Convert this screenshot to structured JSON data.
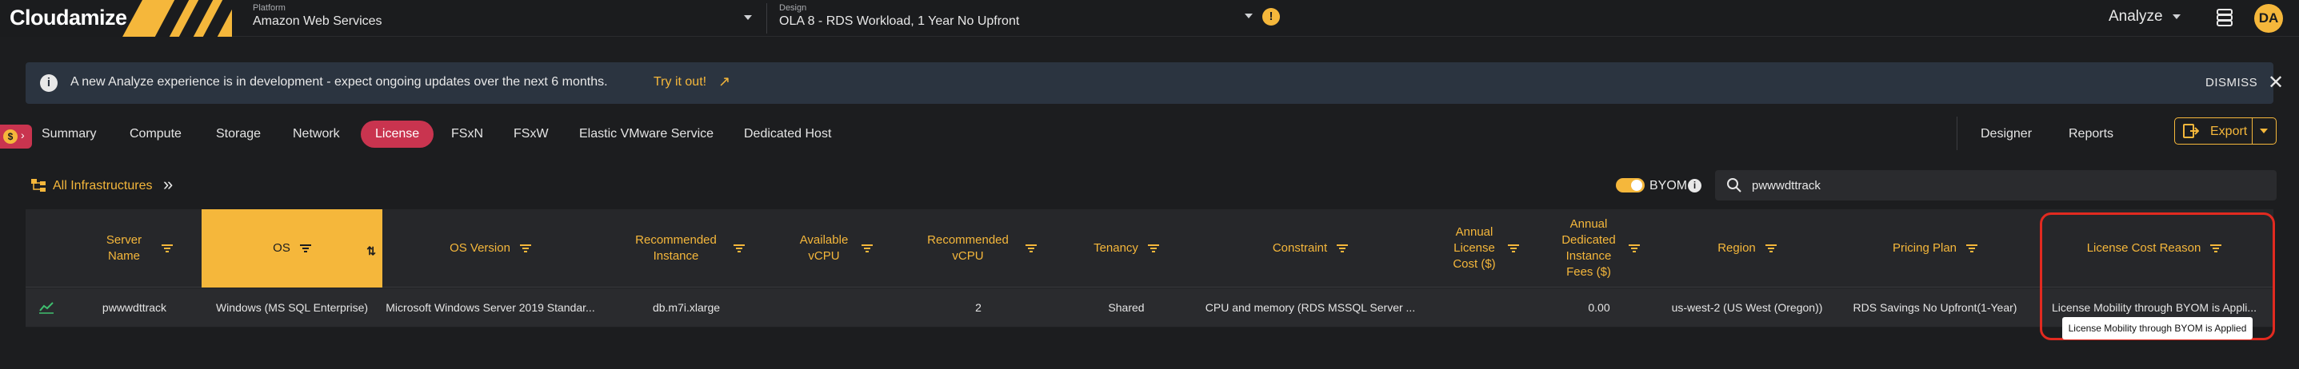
{
  "app": {
    "logo": "Cloudamize",
    "platform": {
      "caption": "Platform",
      "value": "Amazon Web Services"
    },
    "design": {
      "caption": "Design",
      "value": "OLA 8 - RDS Workload, 1 Year No Upfront"
    },
    "analyze_label": "Analyze",
    "avatar_initials": "DA",
    "accent_color": "#f5b73b",
    "active_tab_color": "#c9344f"
  },
  "banner": {
    "text": "A new Analyze experience is in development - expect ongoing updates over the next 6 months.",
    "link": "Try it out!",
    "dismiss": "DISMISS"
  },
  "tabs": [
    {
      "label": "Summary",
      "active": false
    },
    {
      "label": "Compute",
      "active": false
    },
    {
      "label": "Storage",
      "active": false
    },
    {
      "label": "Network",
      "active": false
    },
    {
      "label": "License",
      "active": true
    },
    {
      "label": "FSxN",
      "active": false
    },
    {
      "label": "FSxW",
      "active": false
    },
    {
      "label": "Elastic VMware Service",
      "active": false
    },
    {
      "label": "Dedicated Host",
      "active": false
    }
  ],
  "nav_right": {
    "designer": "Designer",
    "reports": "Reports",
    "export": "Export"
  },
  "toolbar": {
    "breadcrumb": "All Infrastructures",
    "byom_label": "BYOM",
    "byom_on": true,
    "search_value": "pwwwdttrack"
  },
  "table": {
    "columns": [
      {
        "label": "Server Name"
      },
      {
        "label": "OS"
      },
      {
        "label": "OS Version"
      },
      {
        "label": "Recommended Instance"
      },
      {
        "label": "Available vCPU"
      },
      {
        "label": "Recommended vCPU"
      },
      {
        "label": "Tenancy"
      },
      {
        "label": "Constraint"
      },
      {
        "label": "Annual License Cost ($)"
      },
      {
        "label": "Annual Dedicated Instance Fees ($)"
      },
      {
        "label": "Region"
      },
      {
        "label": "Pricing Plan"
      },
      {
        "label": "License Cost Reason"
      }
    ],
    "rows": [
      {
        "server_name": "pwwwdttrack",
        "os": "Windows (MS SQL Enterprise)",
        "os_version": "Microsoft Windows Server 2019 Standar...",
        "recommended_instance": "db.m7i.xlarge",
        "available_vcpu": "",
        "recommended_vcpu": "2",
        "tenancy": "Shared",
        "constraint": "CPU and memory (RDS MSSQL Server ...",
        "annual_license_cost": "",
        "annual_dedicated_fees": "0.00",
        "region": "us-west-2 (US West (Oregon))",
        "pricing_plan": "RDS Savings No Upfront(1-Year)",
        "license_cost_reason": "License Mobility through BYOM is Appli..."
      }
    ]
  },
  "tooltip": "License Mobility through BYOM is Applied"
}
